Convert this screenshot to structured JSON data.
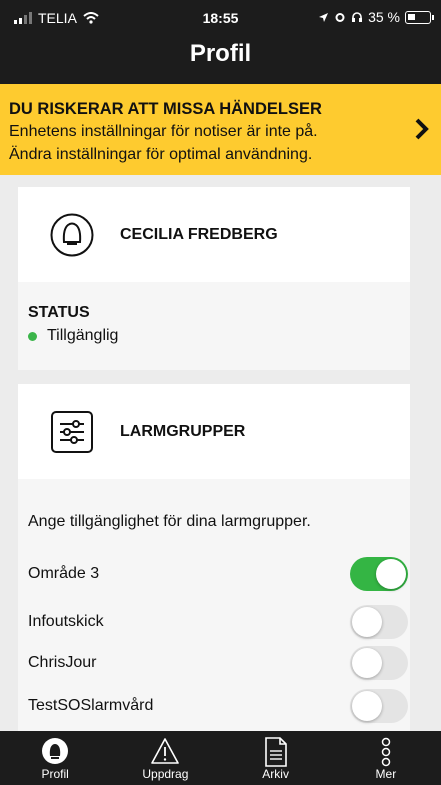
{
  "status_bar": {
    "carrier": "TELIA",
    "time": "18:55",
    "battery": "35 %",
    "battery_level": 0.35
  },
  "header": {
    "title": "Profil"
  },
  "banner": {
    "heading": "DU RISKERAR ATT MISSA HÄNDELSER",
    "line1": "Enhetens inställningar för notiser är inte på.",
    "line2": "Ändra inställningar för optimal användning.",
    "icon": "chevron-right-icon"
  },
  "profile": {
    "name": "CECILIA FREDBERG",
    "status_title": "STATUS",
    "status_value": "Tillgänglig",
    "status_color": "#3bb54a"
  },
  "alarm_groups": {
    "title": "LARMGRUPPER",
    "description": "Ange tillgänglighet för dina larmgrupper.",
    "items": [
      {
        "label": "Område 3",
        "enabled": true
      },
      {
        "label": "Infoutskick",
        "enabled": false
      },
      {
        "label": "ChrisJour",
        "enabled": false
      },
      {
        "label": "TestSOSlarmvård",
        "enabled": false
      }
    ]
  },
  "tabbar": {
    "tabs": [
      {
        "label": "Profil",
        "icon": "profile-icon"
      },
      {
        "label": "Uppdrag",
        "icon": "warning-icon"
      },
      {
        "label": "Arkiv",
        "icon": "document-icon"
      },
      {
        "label": "Mer",
        "icon": "more-icon"
      }
    ]
  },
  "colors": {
    "accent": "#fecb2f",
    "toggle_on": "#34b544",
    "dark": "#1c1c1c"
  }
}
